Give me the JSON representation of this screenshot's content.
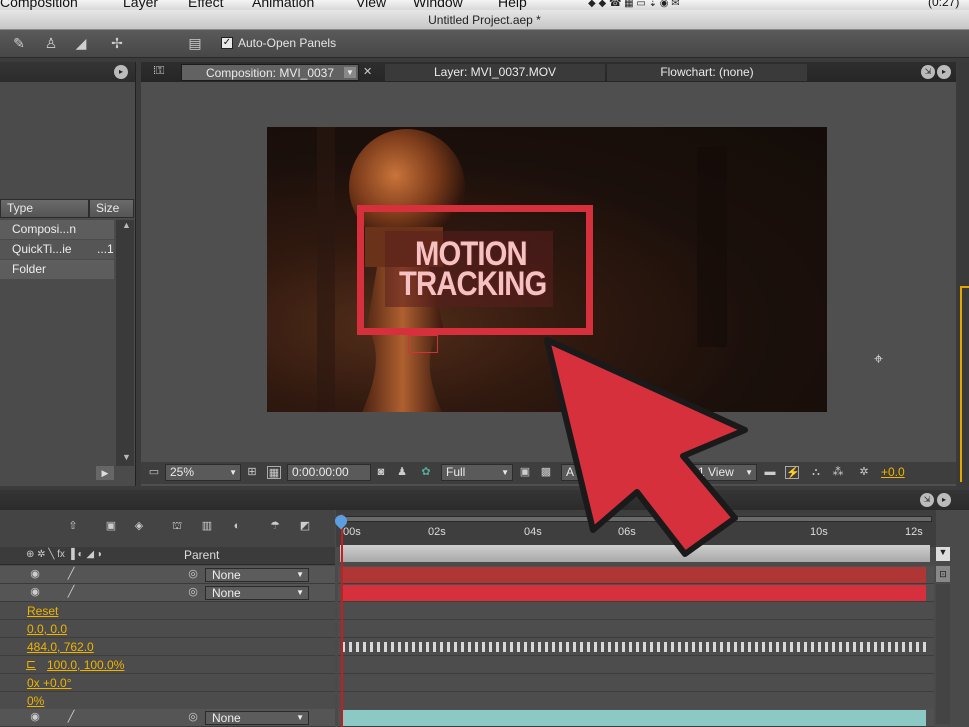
{
  "menubar": {
    "items": [
      "Composition",
      "Layer",
      "Effect",
      "Animation",
      "View",
      "Window",
      "Help"
    ],
    "clock": "(0:27)"
  },
  "window": {
    "title": "Untitled Project.aep *"
  },
  "toolbar": {
    "auto_open_label": "Auto-Open Panels",
    "auto_open_checked": true
  },
  "project": {
    "columns": {
      "type": "Type",
      "size": "Size"
    },
    "rows": [
      {
        "type": "Composi...n",
        "size": ""
      },
      {
        "type": "QuickTi...ie",
        "size": "...1"
      },
      {
        "type": "Folder",
        "size": ""
      }
    ]
  },
  "comp": {
    "tabs": [
      {
        "label": "Composition: MVI_0037"
      },
      {
        "label": "Layer: MVI_0037.MOV"
      },
      {
        "label": "Flowchart: (none)"
      }
    ],
    "overlay": {
      "line1": "MOTION",
      "line2": "TRACKING"
    },
    "bottom": {
      "zoom": "25%",
      "timecode": "0:00:00:00",
      "resolution": "Full",
      "view": "A",
      "view_count": "1 View",
      "exposure": "+0.0"
    }
  },
  "timeline": {
    "parent_header": "Parent",
    "ruler": [
      "00s",
      "02s",
      "04s",
      "06s",
      "10s",
      "12s"
    ],
    "layers": [
      {
        "parent": "None"
      },
      {
        "parent": "None"
      },
      {
        "parent": "None"
      }
    ],
    "properties": [
      "Reset",
      "0.0, 0.0",
      "484.0, 762.0",
      "100.0, 100.0%",
      "0x +0.0°",
      "0%"
    ]
  },
  "colors": {
    "accent_red": "#d6303c",
    "property_value": "#f0b400",
    "track_red": "#c93a3a",
    "track_teal": "#8cc8c4"
  }
}
